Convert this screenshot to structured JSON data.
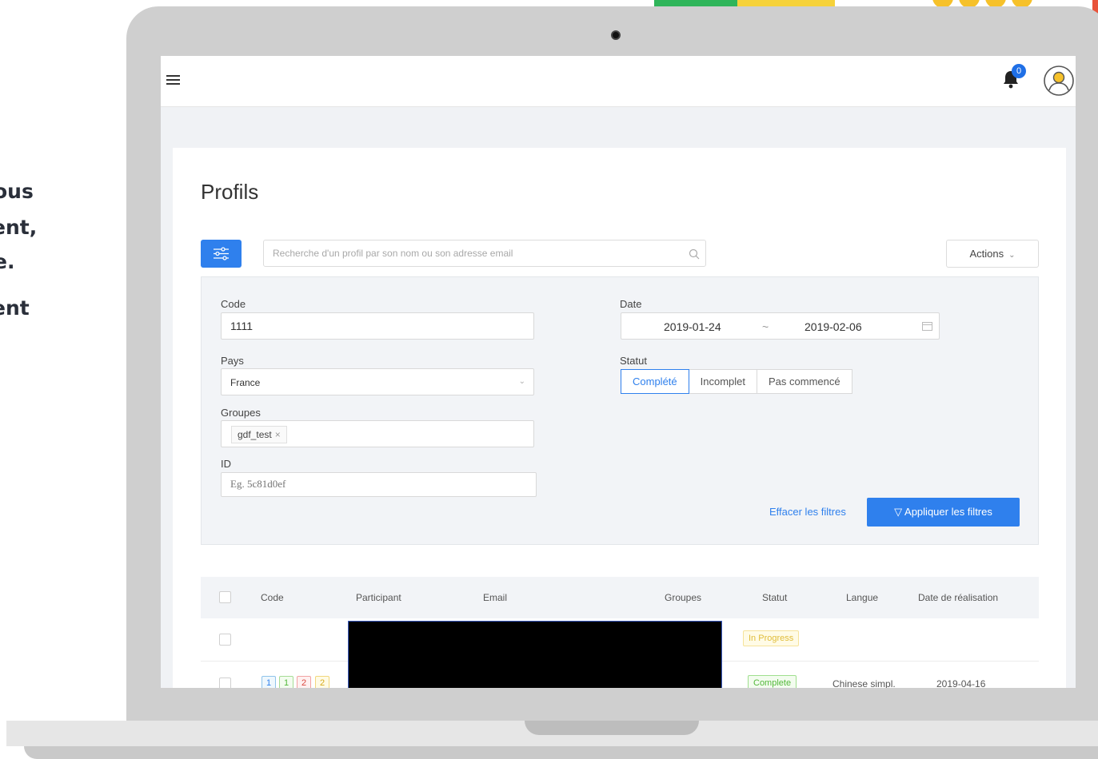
{
  "side_text": [
    "ous",
    "ent,",
    "e.",
    "ent"
  ],
  "colors": {
    "accent": "#2f80ed",
    "deco_green": "#2fb55a",
    "deco_yellow": "#f6d23a",
    "in_progress": "#e0bd3a",
    "complete": "#52b83a"
  },
  "topbar": {
    "menu_icon": "hamburger-icon",
    "notification_count": "0",
    "avatar_icon": "user-circle-icon"
  },
  "page": {
    "title": "Profils"
  },
  "search": {
    "placeholder": "Recherche d'un profil par son nom ou son adresse email",
    "value": ""
  },
  "actions": {
    "label": "Actions"
  },
  "filters": {
    "code_label": "Code",
    "code_value": "1111",
    "date_label": "Date",
    "date_start": "2019-01-24",
    "date_sep": "~",
    "date_end": "2019-02-06",
    "country_label": "Pays",
    "country_value": "France",
    "status_label": "Statut",
    "status_options": [
      "Complété",
      "Incomplet",
      "Pas commencé"
    ],
    "status_selected": "Complété",
    "groups_label": "Groupes",
    "groups_tag": "gdf_test",
    "id_label": "ID",
    "id_placeholder": "Eg. 5c81d0ef",
    "clear_label": "Effacer les filtres",
    "apply_label": "Appliquer les filtres"
  },
  "table": {
    "headers": [
      "Code",
      "Participant",
      "Email",
      "Groupes",
      "Statut",
      "Langue",
      "Date de réalisation"
    ],
    "rows": [
      {
        "codes": [],
        "status": "In Progress",
        "language": "",
        "date": ""
      },
      {
        "codes": [
          "1",
          "1",
          "2",
          "2"
        ],
        "status": "Complete",
        "language": "Chinese simpl.",
        "date": "2019-04-16"
      }
    ]
  }
}
